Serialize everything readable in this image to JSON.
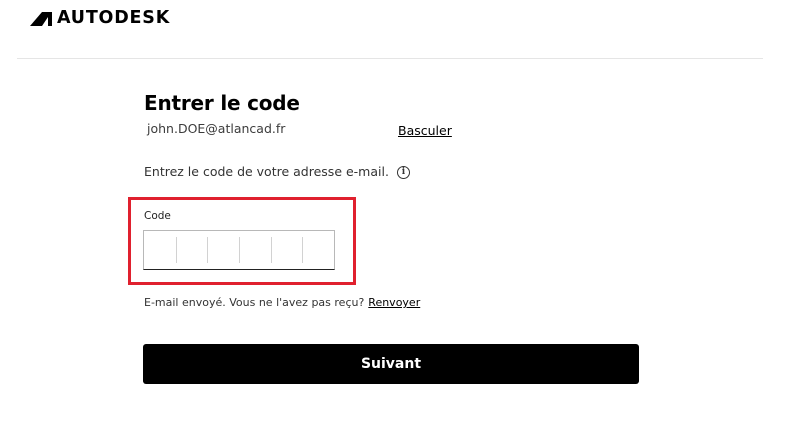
{
  "brand": {
    "name": "AUTODESK",
    "logo_icon": "autodesk-logo-mark"
  },
  "page": {
    "title": "Entrer le code"
  },
  "account": {
    "email": "john.DOE@atlancad.fr",
    "switch_label": "Basculer"
  },
  "instruction": {
    "text": "Entrez le code de votre adresse e-mail.",
    "icon": "info-icon",
    "icon_glyph": "i"
  },
  "code_input": {
    "label": "Code",
    "digit_count": 6,
    "values": [
      "",
      "",
      "",
      "",
      "",
      ""
    ]
  },
  "resend": {
    "text": "E-mail envoyé. Vous ne l'avez pas reçu?",
    "link_label": "Renvoyer"
  },
  "next_button": {
    "label": "Suivant"
  },
  "colors": {
    "highlight": "#e0202e",
    "button_bg": "#000000",
    "button_text": "#ffffff"
  }
}
